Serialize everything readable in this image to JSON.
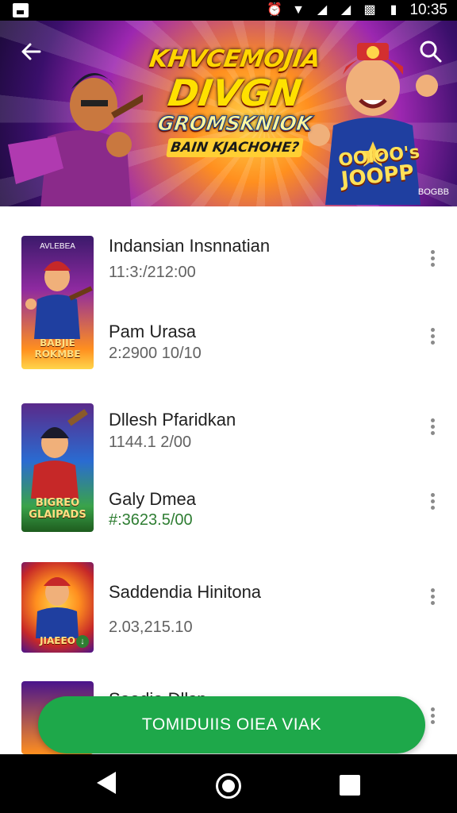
{
  "status_bar": {
    "time": "10:35",
    "icons": [
      "notification-icon",
      "alarm-icon",
      "wifi-icon",
      "signal-icon",
      "no-sim-icon",
      "battery-icon"
    ]
  },
  "hero": {
    "title_line1": "KHVCEMOJIA",
    "title_line2": "DIVGN",
    "title_line3": "GROMSKNIOK",
    "title_line4": "BAIN KJACHOHE?",
    "badge_line1": "OOIOO's",
    "badge_line2": "JOOPP",
    "corner_code": "BOGBB",
    "colors": {
      "accent": "#ffd600",
      "background": "#5a1a8a"
    }
  },
  "items": [
    {
      "thumb_top": "AVLEBEA",
      "thumb_label": "BABJIE ROKMBE",
      "title": "Indansian Insnnatian",
      "subtitle": "11:3:/212:00",
      "title2": "Pam Urasa",
      "subtitle2": "2:2900 10/10"
    },
    {
      "thumb_top": "",
      "thumb_label": "BIGREO GLAIPADS",
      "title": "Dllesh Pfaridkan",
      "subtitle": "1144.1 2/00",
      "title2": "Galy Dmea",
      "subtitle2": "#:3623.5/00"
    },
    {
      "thumb_top": "",
      "thumb_label": "JIAEEO",
      "title": "Saddendia Hinitona",
      "subtitle": "2.03,215.10",
      "title2": "",
      "subtitle2": ""
    },
    {
      "thumb_top": "",
      "thumb_label": "",
      "title": "Saodia Dllsn",
      "subtitle": "",
      "title2": "",
      "subtitle2": ""
    }
  ],
  "cta": {
    "label": "TOMIDUIIS OIEA VIAK",
    "color": "#1ea84a"
  },
  "nav": {
    "back": "back-icon",
    "home": "home-icon",
    "recent": "recent-apps-icon"
  }
}
